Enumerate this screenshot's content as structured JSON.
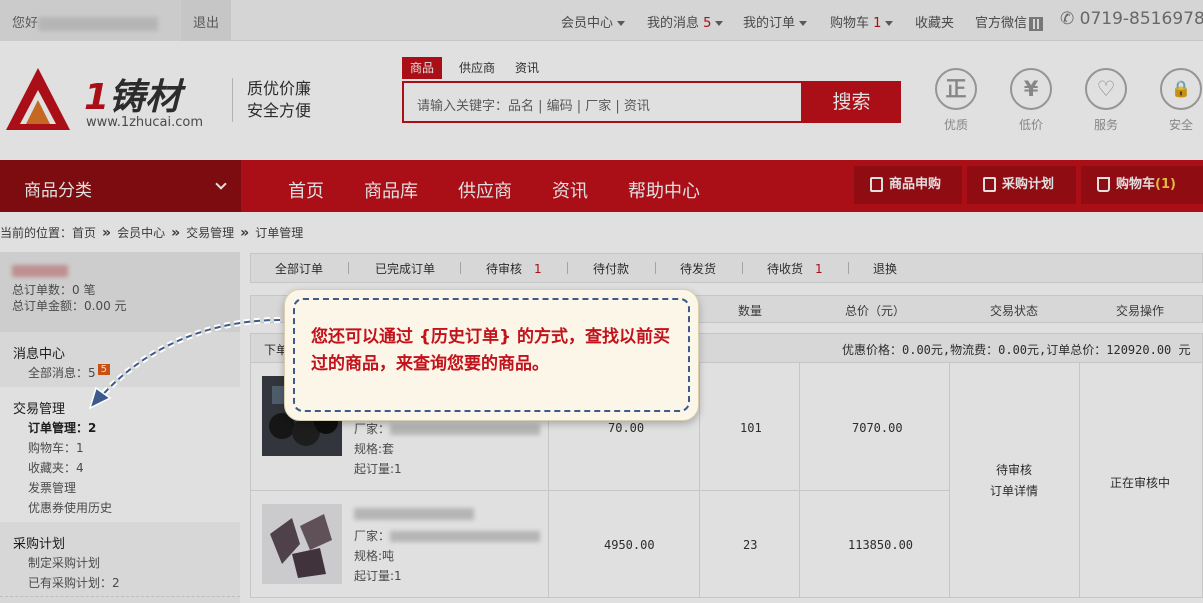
{
  "topbar": {
    "greeting": "您好",
    "logout": "退出",
    "member_center": "会员中心",
    "my_messages": "我的消息",
    "my_messages_count": "5",
    "my_orders": "我的订单",
    "cart": "购物车",
    "cart_count": "1",
    "favorites": "收藏夹",
    "wechat": "官方微信",
    "phone": "0719-8516978"
  },
  "header": {
    "logo_number": "1",
    "logo_text": "铸材",
    "logo_url": "www.1zhucai.com",
    "slogan_line1": "质优价廉",
    "slogan_line2": "安全方便",
    "search_tabs": [
      "商品",
      "供应商",
      "资讯"
    ],
    "search_placeholder": "请输入关键字：品名 | 编码 | 厂家 | 资讯",
    "search_button": "搜索",
    "badges": [
      {
        "glyph": "正",
        "label": "优质"
      },
      {
        "glyph": "¥",
        "label": "低价"
      },
      {
        "glyph": "♡",
        "label": "服务"
      },
      {
        "glyph": "🔒",
        "label": "安全"
      }
    ]
  },
  "nav": {
    "category": "商品分类",
    "items": [
      "首页",
      "商品库",
      "供应商",
      "资讯",
      "帮助中心"
    ],
    "buttons": {
      "apply": "商品申购",
      "plan": "采购计划",
      "cart": "购物车",
      "cart_count": "(1)"
    }
  },
  "breadcrumb": {
    "prefix": "当前的位置：",
    "items": [
      "首页",
      "会员中心",
      "交易管理",
      "订单管理"
    ]
  },
  "sidebar": {
    "order_count": "总订单数：0 笔",
    "order_amount": "总订单金额：0.00 元",
    "msg_title": "消息中心",
    "msg_all": "全部消息：",
    "msg_all_count": "5",
    "msg_badge": "5",
    "trade_title": "交易管理",
    "trade_items": [
      "订单管理：2",
      "购物车：1",
      "收藏夹：4",
      "发票管理",
      "优惠券使用历史"
    ],
    "purchase_title": "采购计划",
    "purchase_items": [
      "制定采购计划",
      "已有采购计划：2"
    ]
  },
  "order_tabs": [
    {
      "label": "全部订单",
      "count": ""
    },
    {
      "label": "已完成订单",
      "count": ""
    },
    {
      "label": "待审核",
      "count": "1"
    },
    {
      "label": "待付款",
      "count": ""
    },
    {
      "label": "待发货",
      "count": ""
    },
    {
      "label": "待收货",
      "count": "1"
    },
    {
      "label": "退换",
      "count": ""
    }
  ],
  "table": {
    "headers": [
      "数量",
      "总价（元）",
      "交易状态",
      "交易操作"
    ],
    "order_label": "下单",
    "order_summary": "优惠价格：0.00元,物流费：0.00元,订单总价：120920.00 元",
    "rows": [
      {
        "maker": "厂家：",
        "spec": "规格:套",
        "moq": "起订量:1",
        "price": "70.00",
        "qty": "101",
        "total": "7070.00"
      },
      {
        "maker": "厂家：",
        "spec": "规格:吨",
        "moq": "起订量:1",
        "price": "4950.00",
        "qty": "23",
        "total": "113850.00"
      }
    ],
    "status": "待审核",
    "detail_link": "订单详情",
    "operation": "正在审核中"
  },
  "callout": {
    "text": "您还可以通过 {历史订单} 的方式，查找以前买过的商品，来查询您要的商品。"
  },
  "colors": {
    "brand_red": "#c2121b",
    "nav_dark": "#8f0e14",
    "callout_bg": "#fbf6e8"
  }
}
